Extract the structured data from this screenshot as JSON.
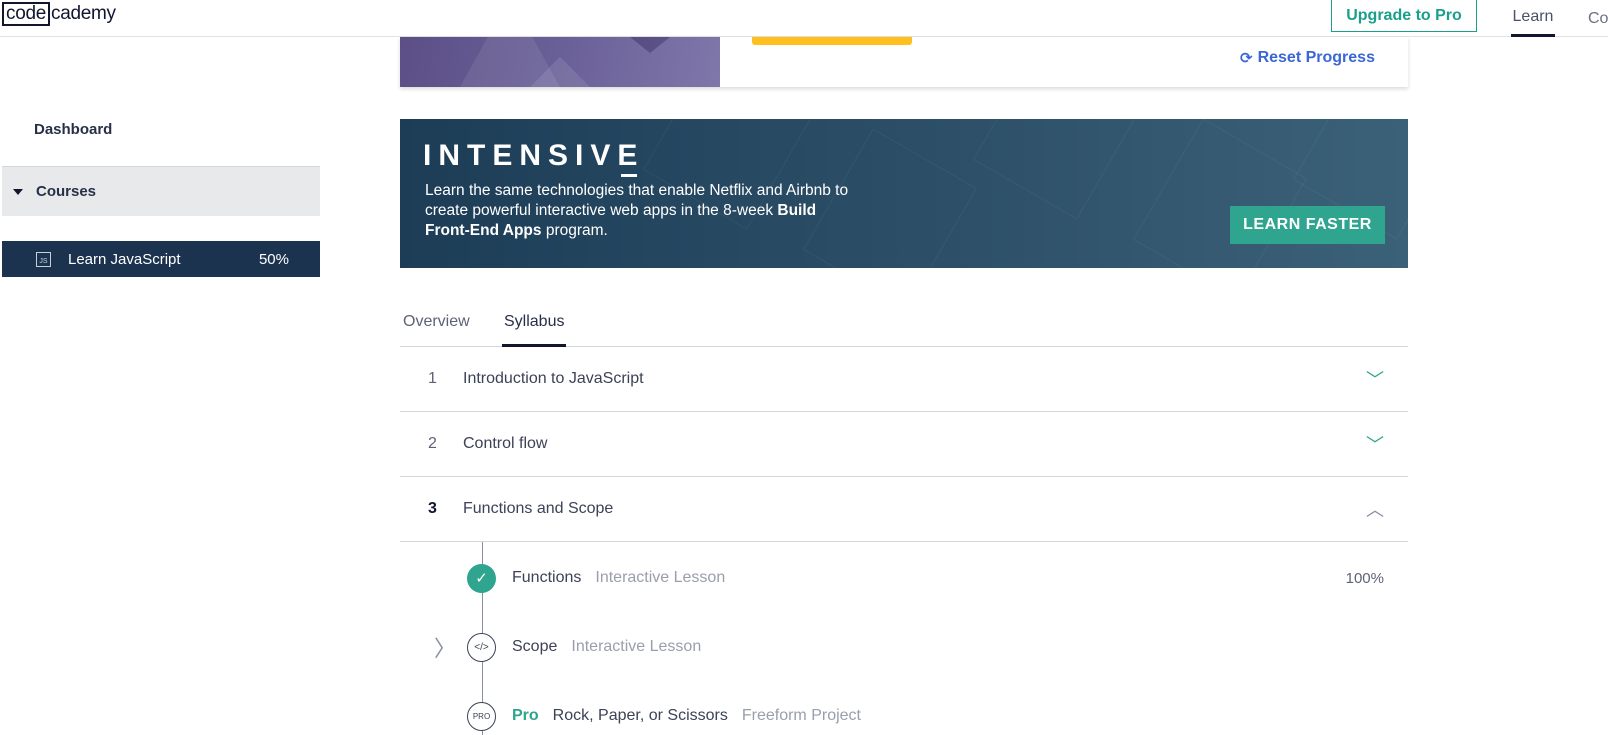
{
  "nav": {
    "logo_box": "code",
    "logo_rest": "cademy",
    "upgrade_label": "Upgrade to Pro",
    "learn_label": "Learn",
    "cut_label": "Co"
  },
  "sidebar": {
    "dashboard": "Dashboard",
    "courses": "Courses",
    "course": {
      "icon_text": "JS",
      "name": "Learn JavaScript",
      "progress": "50%"
    }
  },
  "course_card": {
    "reset_label": "Reset Progress"
  },
  "banner": {
    "title": "INTENSIVE",
    "text_1": "Learn the same technologies that enable Netflix and Airbnb to create powerful interactive web apps in the 8-week ",
    "text_bold": "Build Front-End Apps",
    "text_2": " program.",
    "cta": "LEARN FASTER"
  },
  "tabs": {
    "overview": "Overview",
    "syllabus": "Syllabus"
  },
  "modules": [
    {
      "num": "1",
      "title": "Introduction to JavaScript",
      "chevron": "﹀"
    },
    {
      "num": "2",
      "title": "Control flow",
      "chevron": "﹀"
    },
    {
      "num": "3",
      "title": "Functions and Scope",
      "chevron": "︿"
    }
  ],
  "lessons": [
    {
      "name": "Functions",
      "type": "Interactive Lesson",
      "progress": "100%",
      "marker": "✓"
    },
    {
      "name": "Scope",
      "type": "Interactive Lesson",
      "marker": "</>",
      "side": "〉"
    },
    {
      "pro": "Pro",
      "name": "Rock, Paper, or Scissors",
      "type": "Freeform Project",
      "marker": "PRO"
    }
  ],
  "colors": {
    "accent_teal": "#2fa48e",
    "link_blue": "#3a66d6",
    "sidebar_active": "#1c3350",
    "cta_yellow": "#ffc01e"
  }
}
